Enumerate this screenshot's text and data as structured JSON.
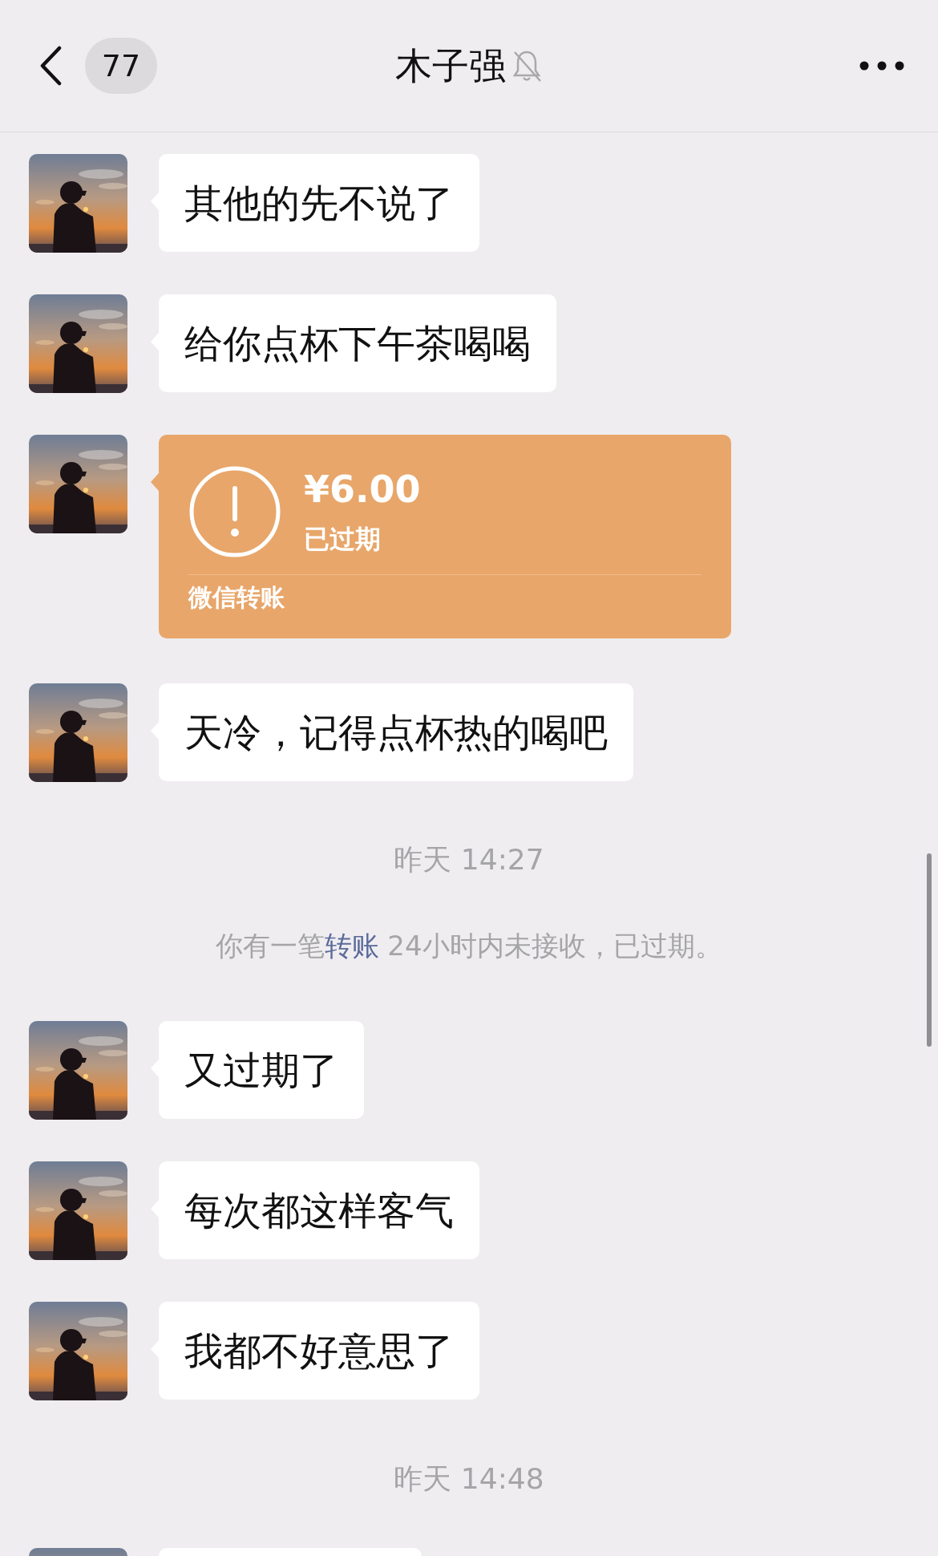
{
  "header": {
    "back_badge": "77",
    "title": "木子强",
    "muted": true
  },
  "messages": [
    {
      "kind": "text",
      "text": "其他的先不说了"
    },
    {
      "kind": "text",
      "text": "给你点杯下午茶喝喝"
    },
    {
      "kind": "transfer",
      "amount": "¥6.00",
      "status": "已过期",
      "label": "微信转账"
    },
    {
      "kind": "text",
      "text": "天冷，记得点杯热的喝吧"
    },
    {
      "kind": "time",
      "text": "昨天 14:27"
    },
    {
      "kind": "system",
      "before": "你有一笔",
      "link": "转账",
      "after": "24小时内未接收，已过期。"
    },
    {
      "kind": "text",
      "text": "又过期了"
    },
    {
      "kind": "text",
      "text": "每次都这样客气"
    },
    {
      "kind": "text",
      "text": "我都不好意思了"
    },
    {
      "kind": "time",
      "text": "昨天 14:48"
    },
    {
      "kind": "partial"
    }
  ]
}
